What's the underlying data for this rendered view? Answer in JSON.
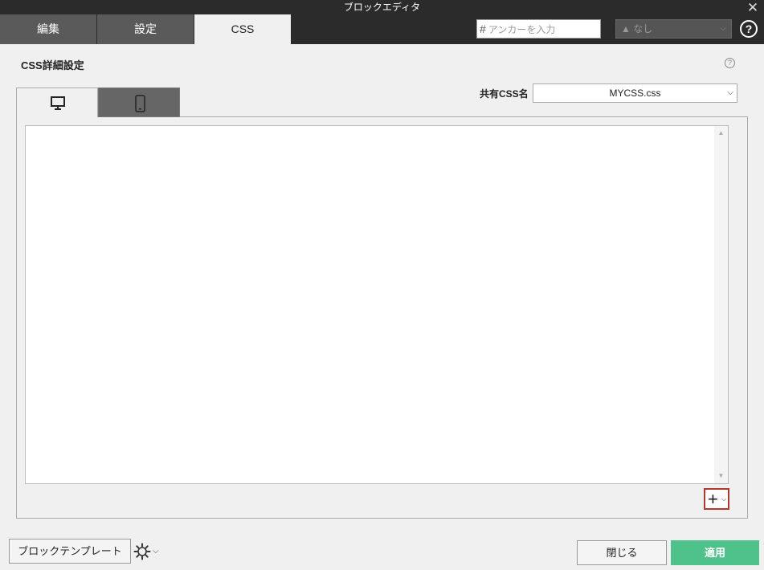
{
  "window": {
    "title": "ブロックエディタ"
  },
  "tabs": [
    {
      "label": "編集"
    },
    {
      "label": "設定"
    },
    {
      "label": "CSS"
    }
  ],
  "anchor": {
    "placeholder": "アンカーを入力"
  },
  "anchor_select": {
    "value": "なし"
  },
  "section": {
    "title": "CSS詳細設定"
  },
  "device_tabs": [
    {
      "icon": "desktop-icon"
    },
    {
      "icon": "mobile-icon"
    }
  ],
  "shared_css": {
    "label": "共有CSS名",
    "value": "MYCSS.css"
  },
  "footer": {
    "template_label": "ブロックテンプレート",
    "close_label": "閉じる",
    "apply_label": "適用"
  },
  "colors": {
    "titlebar": "#2b2b2b",
    "apply": "#4ec28a",
    "highlight": "#b03a2e"
  }
}
